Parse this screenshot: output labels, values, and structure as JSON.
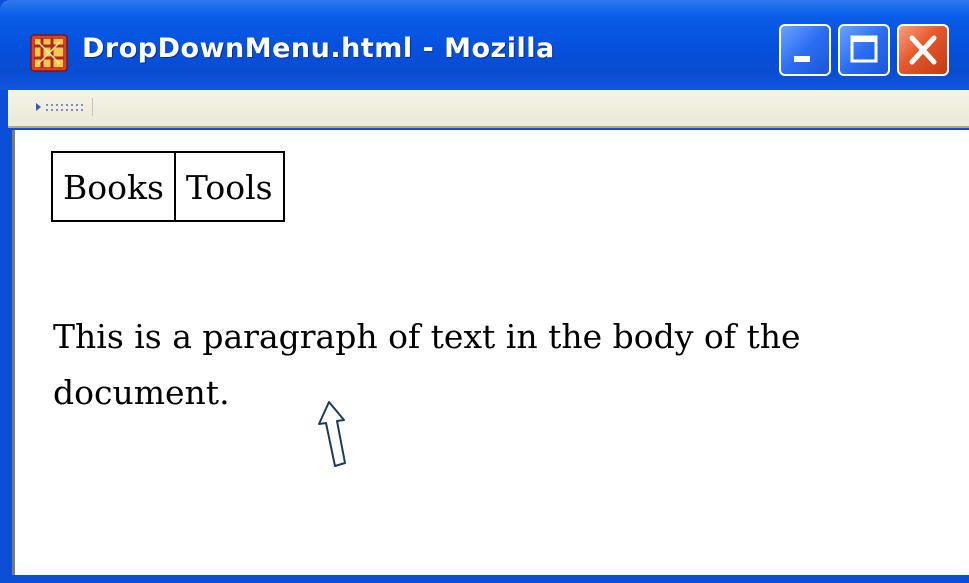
{
  "window": {
    "title": "DropDownMenu.html - Mozilla",
    "controls": [
      "minimize",
      "maximize",
      "close"
    ]
  },
  "icons": {
    "app": "mozilla-app-icon",
    "grip": "toolbar-grip-icon",
    "minimize": "minimize-icon",
    "maximize": "maximize-icon",
    "close": "close-icon",
    "pointer": "up-arrow-icon"
  },
  "menu": {
    "items": [
      {
        "label": "Books"
      },
      {
        "label": "Tools"
      }
    ]
  },
  "body": {
    "paragraph": "This is a paragraph of text in the body of the document."
  },
  "colors": {
    "titlebar": "#0550dc",
    "close_button": "#e4582c",
    "toolbar": "#ece9d8"
  }
}
